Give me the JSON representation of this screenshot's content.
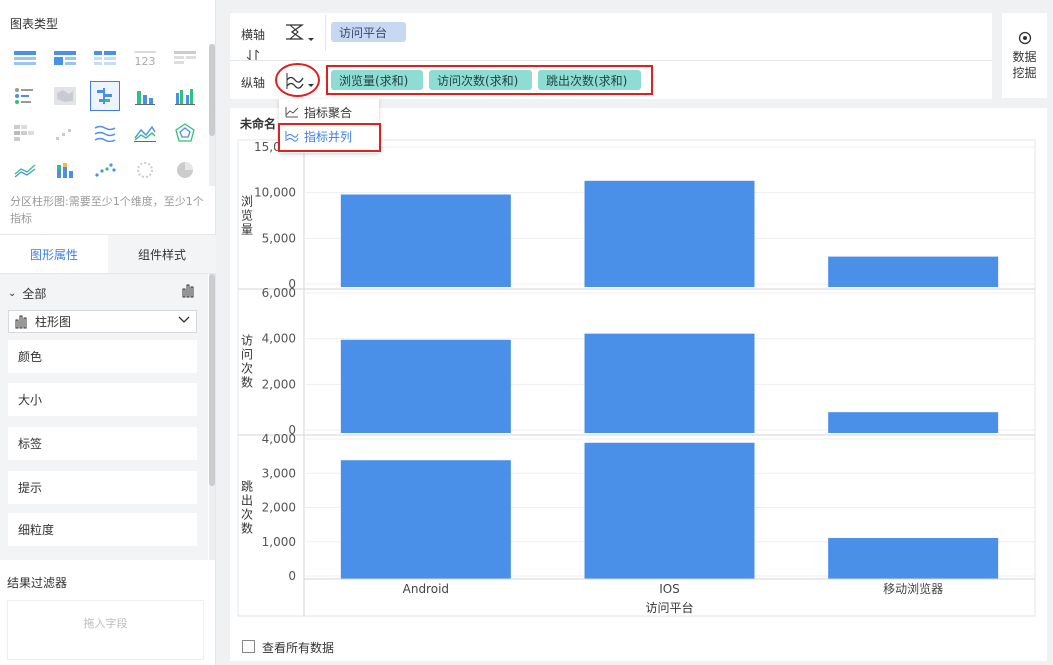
{
  "left_panel": {
    "chart_type_title": "图表类型",
    "chart_type_hint": "分区柱形图:需要至少1个维度，至少1个指标",
    "tabs": [
      "图形属性",
      "组件样式"
    ],
    "all_label": "全部",
    "selected_type": "柱形图",
    "props": [
      "颜色",
      "大小",
      "标签",
      "提示",
      "细粒度"
    ],
    "filter_title": "结果过滤器",
    "drop_placeholder": "拖入字段"
  },
  "field_bar": {
    "x_axis_label": "横轴",
    "y_axis_label": "纵轴",
    "x_field": "访问平台",
    "y_fields": [
      "浏览量(求和)",
      "访问次数(求和)",
      "跳出次数(求和)"
    ],
    "mine_label": "数据挖掘"
  },
  "dropdown": {
    "items": [
      "指标聚合",
      "指标并列"
    ],
    "active_index": 1
  },
  "colors": {
    "bar": "#4a90e8",
    "accent": "#3d7ee8",
    "highlight": "#e01f1f"
  },
  "chart_title": "未命名",
  "show_all_label": "查看所有数据",
  "chart_data": {
    "type": "bar",
    "categories": [
      "Android",
      "IOS",
      "移动浏览器"
    ],
    "xlabel": "访问平台",
    "series": [
      {
        "name": "浏览量",
        "values": [
          9800,
          11300,
          3000
        ],
        "ylim": [
          0,
          15000
        ],
        "ticks": [
          "0",
          "5,000",
          "10,000",
          "15,000"
        ],
        "tick_values": [
          0,
          5000,
          10000,
          15000
        ]
      },
      {
        "name": "访问次数",
        "values": [
          3950,
          4220,
          780
        ],
        "ylim": [
          0,
          6000
        ],
        "ticks": [
          "0",
          "2,000",
          "4,000",
          "6,000"
        ],
        "tick_values": [
          0,
          2000,
          4000,
          6000
        ]
      },
      {
        "name": "跳出次数",
        "values": [
          3380,
          3890,
          1110
        ],
        "ylim": [
          0,
          4000
        ],
        "ticks": [
          "0",
          "1,000",
          "2,000",
          "3,000",
          "4,000"
        ],
        "tick_values": [
          0,
          1000,
          2000,
          3000,
          4000
        ]
      }
    ]
  }
}
